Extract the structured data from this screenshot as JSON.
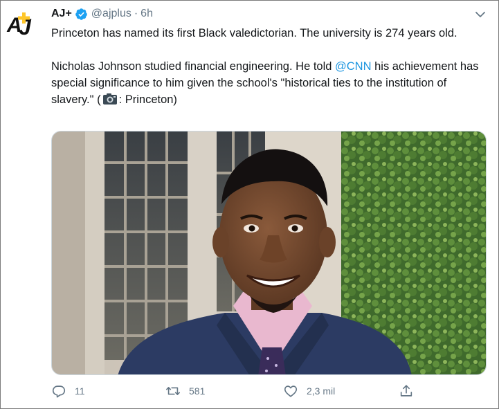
{
  "account": {
    "display_name": "AJ+",
    "handle": "@ajplus",
    "separator": "·",
    "time": "6h",
    "avatar_text": "AJ+",
    "verified_icon": "verified-badge-icon",
    "brand_color": "#ffc629"
  },
  "tweet": {
    "line1": "Princeton has named its first Black valedictorian. The university is 274 years old.",
    "line2_pre": "Nicholas Johnson studied financial engineering. He told ",
    "mention": "@CNN",
    "line2_post": " his achievement has special significance to him given the school's \"historical ties to the institution of slavery.\" (",
    "credit": ": Princeton)",
    "camera_icon": "camera-icon",
    "mention_color": "#1b95e0"
  },
  "media": {
    "photo_description_icon": "photo"
  },
  "actions": {
    "reply_count": "11",
    "retweet_count": "581",
    "like_count": "2,3 mil",
    "muted_color": "#657786"
  }
}
